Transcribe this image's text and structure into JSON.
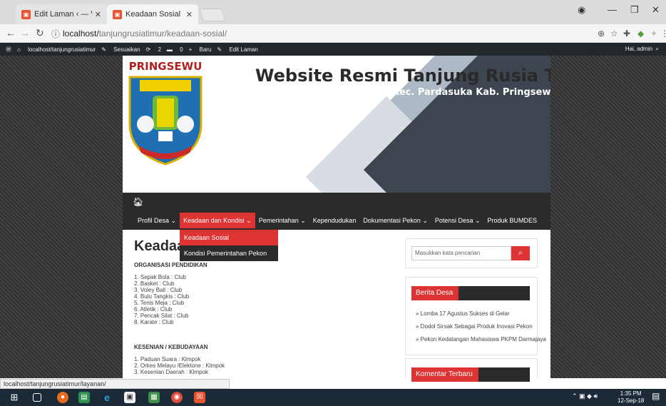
{
  "browser": {
    "tabs": [
      {
        "label": "Edit Laman ‹ — WordPre",
        "active": false
      },
      {
        "label": "Keadaan Sosial",
        "active": true
      }
    ],
    "url_host": "localhost/",
    "url_path": "tanjungrusiatimur/keadaan-sosial/",
    "status_url": "localhost/tanjungrusiatimur/layanan/"
  },
  "adminbar": {
    "site": "localhost/tanjungrusiatimur",
    "customize": "Sesuaikan",
    "updates": "2",
    "comments": "0",
    "new": "Baru",
    "edit": "Edit Laman",
    "greeting": "Hai, admin"
  },
  "header": {
    "logo_text": "PRINGSEWU",
    "title": "Website Resmi Tanjung Rusia Timur",
    "subtitle": "Kec. Pardasuka Kab. Pringsewu"
  },
  "nav": {
    "items": [
      {
        "label": "Profil Desa ⌄",
        "active": false
      },
      {
        "label": "Keadaan dan Kondisi ⌄",
        "active": true
      },
      {
        "label": "Pemerintahan ⌄",
        "active": false
      },
      {
        "label": "Kependudukan",
        "active": false
      },
      {
        "label": "Dokumentasi Pekon ⌄",
        "active": false
      },
      {
        "label": "Potensi Desa ⌄",
        "active": false
      },
      {
        "label": "Produk BUMDES",
        "active": false
      }
    ],
    "dropdown": [
      {
        "label": "Keadaan Sosial",
        "active": true
      },
      {
        "label": "Kondisi Pemerintahan Pekon",
        "active": false
      }
    ]
  },
  "main": {
    "title": "Keadaan Sosial",
    "section1": "ORGANISASI PENDIDIKAN",
    "list1": [
      "1. Sepak Bola :  Club",
      "2. Basket :    Club",
      "3. Voley Ball :  Club",
      "4. Bulu Tangkis :  Club",
      "5. Tenis Meja :  Club",
      "6. Atletik :    Club",
      "7. Pencak Silat :  Club",
      "8. Karate :  Club"
    ],
    "section2": "KESENIAN / KEBUDAYAAN",
    "list2": [
      "1. Paduan Suara :  Klmpok",
      "2. Orkes Melayu /Elektone :   Klmpok",
      "3. Kesenian Daerah :  Klmpok"
    ]
  },
  "sidebar": {
    "search_placeholder": "Masukkan kata pencarian",
    "news_title": "Berita Desa",
    "news": [
      "»  Lomba 17 Agustus Sukses di Gelar",
      "»  Dodol Sirsak Sebagai Produk Inovasi Pekon",
      "»  Pekon Kedatangan Mahasiswa PKPM Darmajaya"
    ],
    "comments_title": "Komentar Terbaru"
  },
  "taskbar": {
    "time": "1:35 PM",
    "date": "12-Sep-18"
  }
}
